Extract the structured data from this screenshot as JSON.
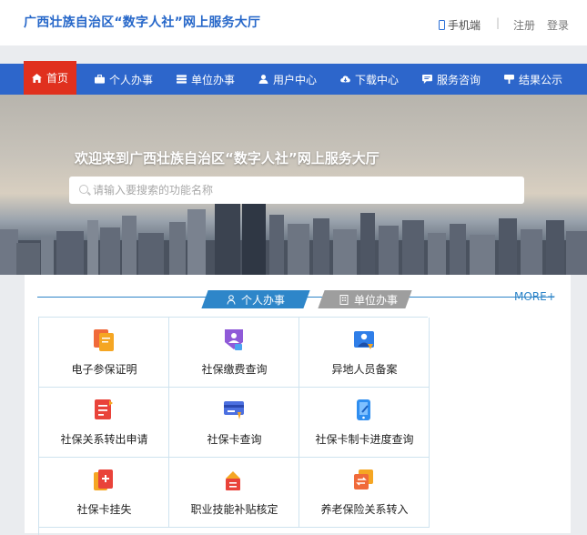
{
  "header": {
    "title": "广西壮族自治区“数字人社”网上服务大厅",
    "mobile": "手机端",
    "separator": "|",
    "register": "注册",
    "login": "登录"
  },
  "nav": {
    "items": [
      {
        "label": "首页",
        "icon": "home-icon"
      },
      {
        "label": "个人办事",
        "icon": "briefcase-icon"
      },
      {
        "label": "单位办事",
        "icon": "stack-icon"
      },
      {
        "label": "用户中心",
        "icon": "user-icon"
      },
      {
        "label": "下载中心",
        "icon": "cloud-download-icon"
      },
      {
        "label": "服务咨询",
        "icon": "chat-icon"
      },
      {
        "label": "结果公示",
        "icon": "megaphone-icon"
      }
    ],
    "active_index": 0
  },
  "banner": {
    "welcome": "欢迎来到广西壮族自治区“数字人社”网上服务大厅",
    "search_placeholder": "请输入要搜索的功能名称"
  },
  "services": {
    "tabs": {
      "personal": "个人办事",
      "unit": "单位办事"
    },
    "more": "MORE+",
    "items": [
      {
        "label": "电子参保证明",
        "icon": "certificate-icon"
      },
      {
        "label": "社保缴费查询",
        "icon": "payment-query-icon"
      },
      {
        "label": "异地人员备案",
        "icon": "relocation-filing-icon"
      },
      {
        "label": "社保关系转出申请",
        "icon": "transfer-out-icon"
      },
      {
        "label": "社保卡查询",
        "icon": "card-query-icon"
      },
      {
        "label": "社保卡制卡进度查询",
        "icon": "card-progress-icon"
      },
      {
        "label": "社保卡挂失",
        "icon": "card-loss-icon"
      },
      {
        "label": "职业技能补贴核定",
        "icon": "skill-subsidy-icon"
      },
      {
        "label": "养老保险关系转入",
        "icon": "pension-transfer-icon"
      }
    ]
  },
  "colors": {
    "brand_blue": "#2d66cb",
    "active_red": "#e0301e",
    "title_blue": "#2667c9",
    "tab_blue": "#2e86c9",
    "tab_gray": "#9e9e9e"
  }
}
